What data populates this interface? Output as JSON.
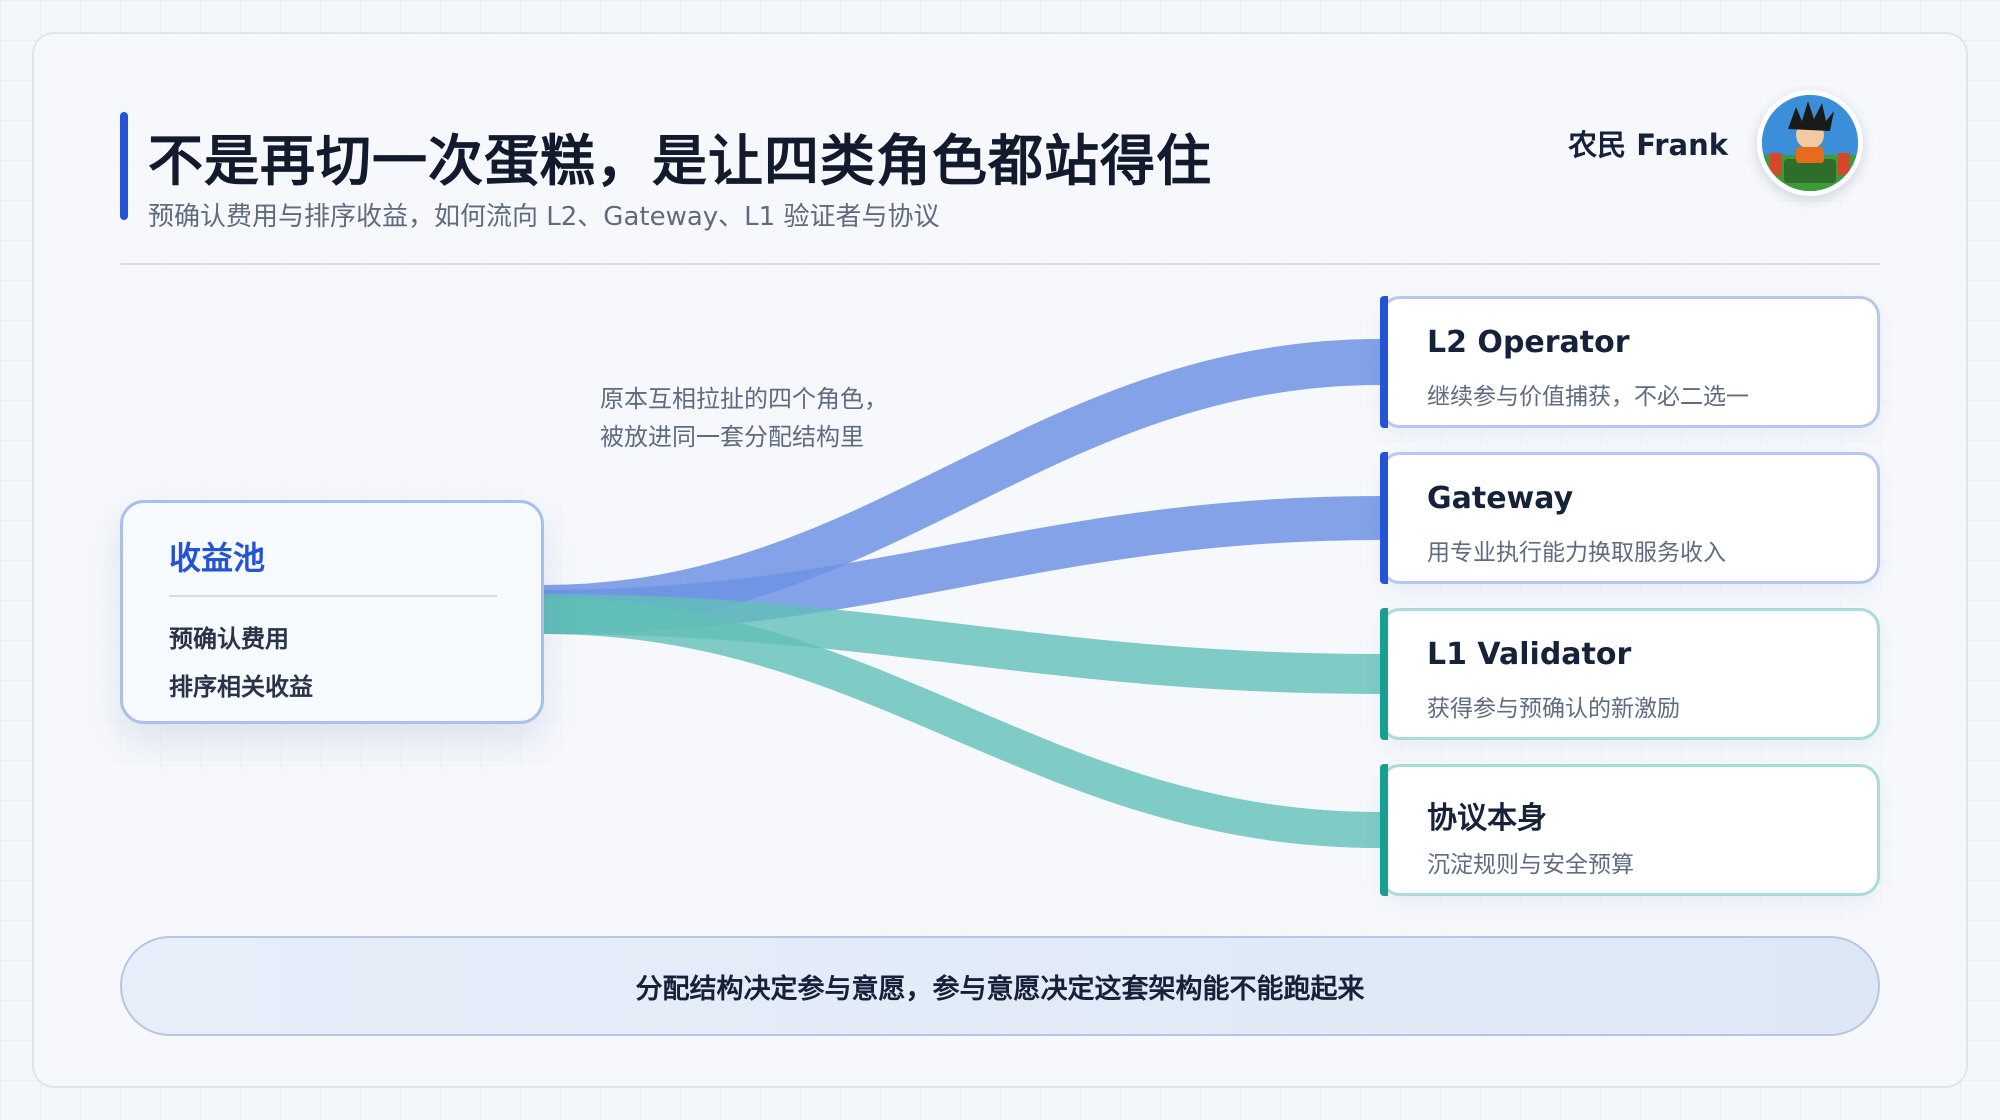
{
  "header": {
    "title": "不是再切一次蛋糕，是让四类角色都站得住",
    "subtitle": "预确认费用与排序收益，如何流向 L2、Gateway、L1 验证者与协议",
    "author": "农民 Frank"
  },
  "annotation": [
    "原本互相拉扯的四个角色，",
    "被放进同一套分配结构里"
  ],
  "pool": {
    "title": "收益池",
    "items": [
      "预确认费用",
      "排序相关收益"
    ]
  },
  "roles": [
    {
      "title": "L2 Operator",
      "desc": "继续参与价值捕获，不必二选一",
      "color": "#2553d6"
    },
    {
      "title": "Gateway",
      "desc": "用专业执行能力换取服务收入",
      "color": "#2553d6"
    },
    {
      "title": "L1 Validator",
      "desc": "获得参与预确认的新激励",
      "color": "#179f92"
    },
    {
      "title": "协议本身",
      "desc": "沉淀规则与安全预算",
      "color": "#179f92"
    }
  ],
  "footer": {
    "text": "分配结构决定参与意愿，参与意愿决定这套架构能不能跑起来"
  },
  "colors": {
    "accent_blue": "#2553d6",
    "accent_teal": "#179f92",
    "flow_blue": "#6f93e4",
    "flow_teal": "#62bfb6"
  }
}
